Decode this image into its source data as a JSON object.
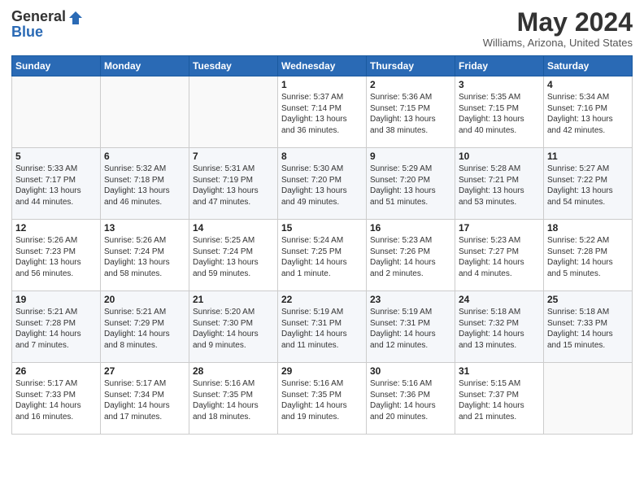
{
  "logo": {
    "general": "General",
    "blue": "Blue"
  },
  "title": "May 2024",
  "location": "Williams, Arizona, United States",
  "days_of_week": [
    "Sunday",
    "Monday",
    "Tuesday",
    "Wednesday",
    "Thursday",
    "Friday",
    "Saturday"
  ],
  "weeks": [
    [
      {
        "day": "",
        "info": ""
      },
      {
        "day": "",
        "info": ""
      },
      {
        "day": "",
        "info": ""
      },
      {
        "day": "1",
        "info": "Sunrise: 5:37 AM\nSunset: 7:14 PM\nDaylight: 13 hours\nand 36 minutes."
      },
      {
        "day": "2",
        "info": "Sunrise: 5:36 AM\nSunset: 7:15 PM\nDaylight: 13 hours\nand 38 minutes."
      },
      {
        "day": "3",
        "info": "Sunrise: 5:35 AM\nSunset: 7:15 PM\nDaylight: 13 hours\nand 40 minutes."
      },
      {
        "day": "4",
        "info": "Sunrise: 5:34 AM\nSunset: 7:16 PM\nDaylight: 13 hours\nand 42 minutes."
      }
    ],
    [
      {
        "day": "5",
        "info": "Sunrise: 5:33 AM\nSunset: 7:17 PM\nDaylight: 13 hours\nand 44 minutes."
      },
      {
        "day": "6",
        "info": "Sunrise: 5:32 AM\nSunset: 7:18 PM\nDaylight: 13 hours\nand 46 minutes."
      },
      {
        "day": "7",
        "info": "Sunrise: 5:31 AM\nSunset: 7:19 PM\nDaylight: 13 hours\nand 47 minutes."
      },
      {
        "day": "8",
        "info": "Sunrise: 5:30 AM\nSunset: 7:20 PM\nDaylight: 13 hours\nand 49 minutes."
      },
      {
        "day": "9",
        "info": "Sunrise: 5:29 AM\nSunset: 7:20 PM\nDaylight: 13 hours\nand 51 minutes."
      },
      {
        "day": "10",
        "info": "Sunrise: 5:28 AM\nSunset: 7:21 PM\nDaylight: 13 hours\nand 53 minutes."
      },
      {
        "day": "11",
        "info": "Sunrise: 5:27 AM\nSunset: 7:22 PM\nDaylight: 13 hours\nand 54 minutes."
      }
    ],
    [
      {
        "day": "12",
        "info": "Sunrise: 5:26 AM\nSunset: 7:23 PM\nDaylight: 13 hours\nand 56 minutes."
      },
      {
        "day": "13",
        "info": "Sunrise: 5:26 AM\nSunset: 7:24 PM\nDaylight: 13 hours\nand 58 minutes."
      },
      {
        "day": "14",
        "info": "Sunrise: 5:25 AM\nSunset: 7:24 PM\nDaylight: 13 hours\nand 59 minutes."
      },
      {
        "day": "15",
        "info": "Sunrise: 5:24 AM\nSunset: 7:25 PM\nDaylight: 14 hours\nand 1 minute."
      },
      {
        "day": "16",
        "info": "Sunrise: 5:23 AM\nSunset: 7:26 PM\nDaylight: 14 hours\nand 2 minutes."
      },
      {
        "day": "17",
        "info": "Sunrise: 5:23 AM\nSunset: 7:27 PM\nDaylight: 14 hours\nand 4 minutes."
      },
      {
        "day": "18",
        "info": "Sunrise: 5:22 AM\nSunset: 7:28 PM\nDaylight: 14 hours\nand 5 minutes."
      }
    ],
    [
      {
        "day": "19",
        "info": "Sunrise: 5:21 AM\nSunset: 7:28 PM\nDaylight: 14 hours\nand 7 minutes."
      },
      {
        "day": "20",
        "info": "Sunrise: 5:21 AM\nSunset: 7:29 PM\nDaylight: 14 hours\nand 8 minutes."
      },
      {
        "day": "21",
        "info": "Sunrise: 5:20 AM\nSunset: 7:30 PM\nDaylight: 14 hours\nand 9 minutes."
      },
      {
        "day": "22",
        "info": "Sunrise: 5:19 AM\nSunset: 7:31 PM\nDaylight: 14 hours\nand 11 minutes."
      },
      {
        "day": "23",
        "info": "Sunrise: 5:19 AM\nSunset: 7:31 PM\nDaylight: 14 hours\nand 12 minutes."
      },
      {
        "day": "24",
        "info": "Sunrise: 5:18 AM\nSunset: 7:32 PM\nDaylight: 14 hours\nand 13 minutes."
      },
      {
        "day": "25",
        "info": "Sunrise: 5:18 AM\nSunset: 7:33 PM\nDaylight: 14 hours\nand 15 minutes."
      }
    ],
    [
      {
        "day": "26",
        "info": "Sunrise: 5:17 AM\nSunset: 7:33 PM\nDaylight: 14 hours\nand 16 minutes."
      },
      {
        "day": "27",
        "info": "Sunrise: 5:17 AM\nSunset: 7:34 PM\nDaylight: 14 hours\nand 17 minutes."
      },
      {
        "day": "28",
        "info": "Sunrise: 5:16 AM\nSunset: 7:35 PM\nDaylight: 14 hours\nand 18 minutes."
      },
      {
        "day": "29",
        "info": "Sunrise: 5:16 AM\nSunset: 7:35 PM\nDaylight: 14 hours\nand 19 minutes."
      },
      {
        "day": "30",
        "info": "Sunrise: 5:16 AM\nSunset: 7:36 PM\nDaylight: 14 hours\nand 20 minutes."
      },
      {
        "day": "31",
        "info": "Sunrise: 5:15 AM\nSunset: 7:37 PM\nDaylight: 14 hours\nand 21 minutes."
      },
      {
        "day": "",
        "info": ""
      }
    ]
  ]
}
